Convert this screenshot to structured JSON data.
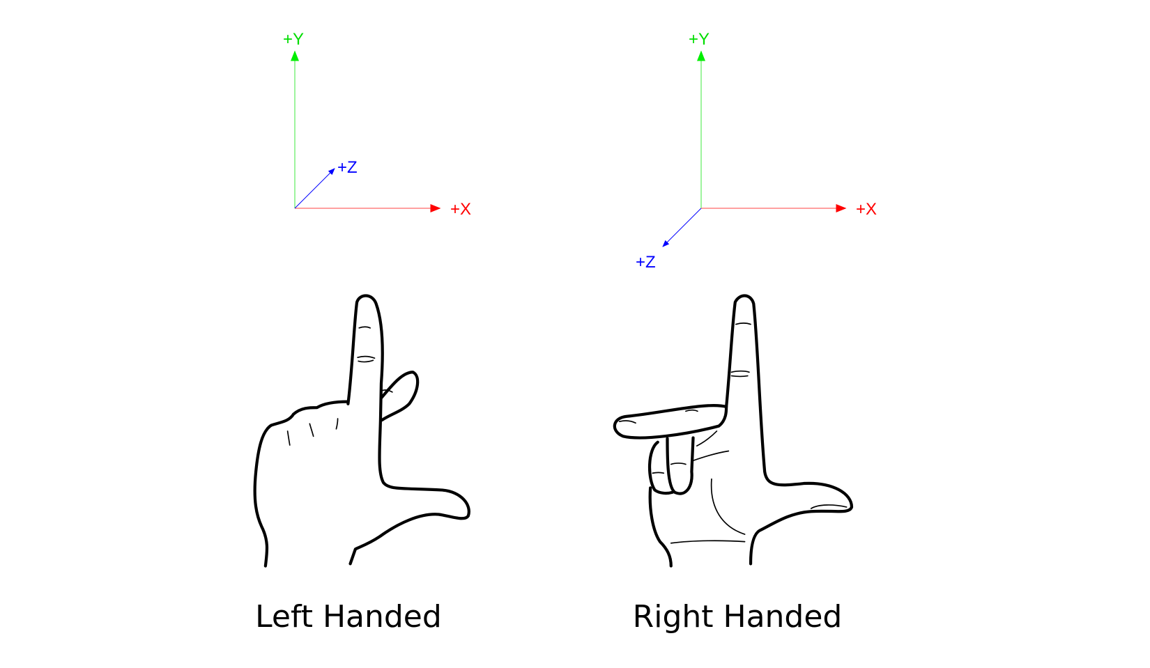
{
  "colors": {
    "x_axis": "#ff0000",
    "y_axis": "#00ee00",
    "z_axis": "#0000ff",
    "text": "#000000"
  },
  "left": {
    "caption": "Left Handed",
    "axes": {
      "x_label": "+X",
      "y_label": "+Y",
      "z_label": "+Z",
      "z_direction": "into screen"
    }
  },
  "right": {
    "caption": "Right Handed",
    "axes": {
      "x_label": "+X",
      "y_label": "+Y",
      "z_label": "+Z",
      "z_direction": "out of screen"
    }
  },
  "icons": {
    "left_hand": "left-hand-gesture-icon",
    "right_hand": "right-hand-gesture-icon"
  }
}
